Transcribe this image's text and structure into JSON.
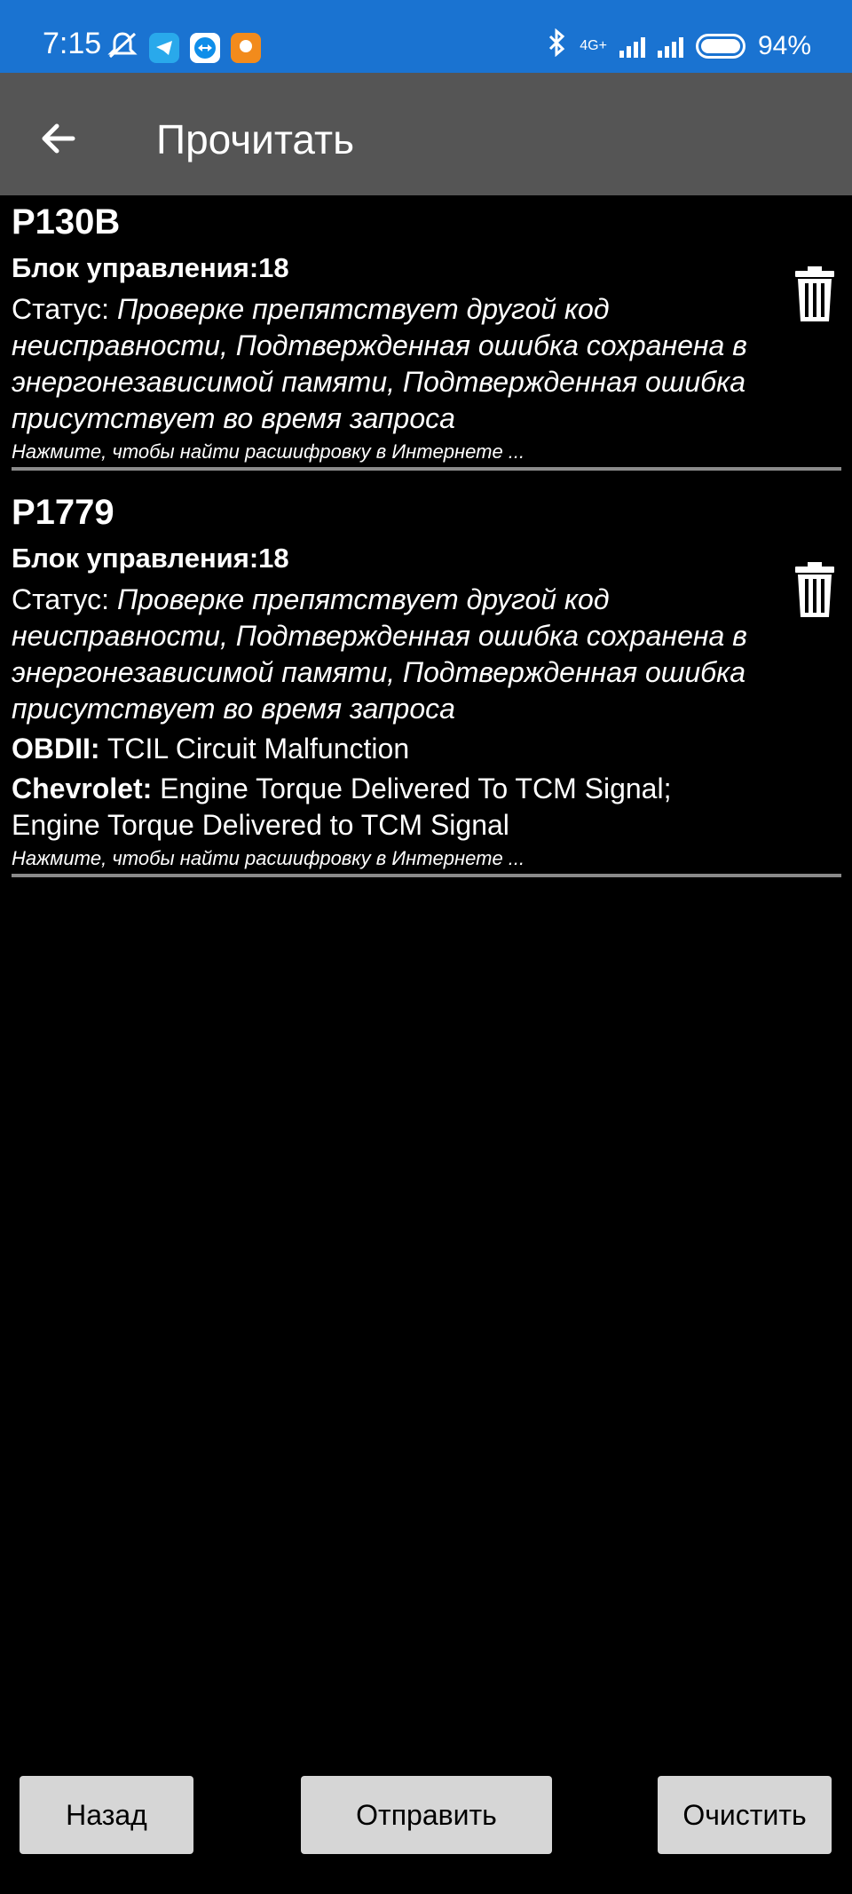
{
  "status_bar": {
    "time": "7:15",
    "network": "4G+",
    "battery": "94%",
    "icons": [
      "bell-off-icon",
      "telegram-icon",
      "teamviewer-icon",
      "app-icon",
      "bluetooth-icon",
      "signal-icon",
      "signal-icon",
      "battery-icon"
    ]
  },
  "appbar": {
    "title": "Прочитать",
    "back_icon": "arrow-left-icon"
  },
  "entries": [
    {
      "code": "P130B",
      "block": "Блок управления:18",
      "status_label": "Статус: ",
      "status_value": "Проверке препятствует другой код неисправности, Подтвержденная ошибка сохранена в энергонезависимой памяти, Подтвержденная ошибка присутствует во время запроса",
      "hint": "Нажмите, чтобы найти расшифровку в Интернете ..."
    },
    {
      "code": "P1779",
      "block": "Блок управления:18",
      "status_label": "Статус: ",
      "status_value": "Проверке препятствует другой код неисправности, Подтвержденная ошибка сохранена в энергонезависимой памяти, Подтвержденная ошибка присутствует во время запроса",
      "obd_label": "OBDII:",
      "obd_value": " TCIL Circuit Malfunction",
      "maker_label": "Chevrolet:",
      "maker_value": " Engine Torque Delivered To TCM Signal; Engine Torque Delivered to TCM Signal",
      "hint": "Нажмите, чтобы найти расшифровку в Интернете ..."
    }
  ],
  "buttons": {
    "back": "Назад",
    "send": "Отправить",
    "clear": "Очистить"
  },
  "colors": {
    "status_bar": "#1a73d1",
    "app_bar": "#555555",
    "background": "#000000",
    "button": "#d6d6d6"
  }
}
